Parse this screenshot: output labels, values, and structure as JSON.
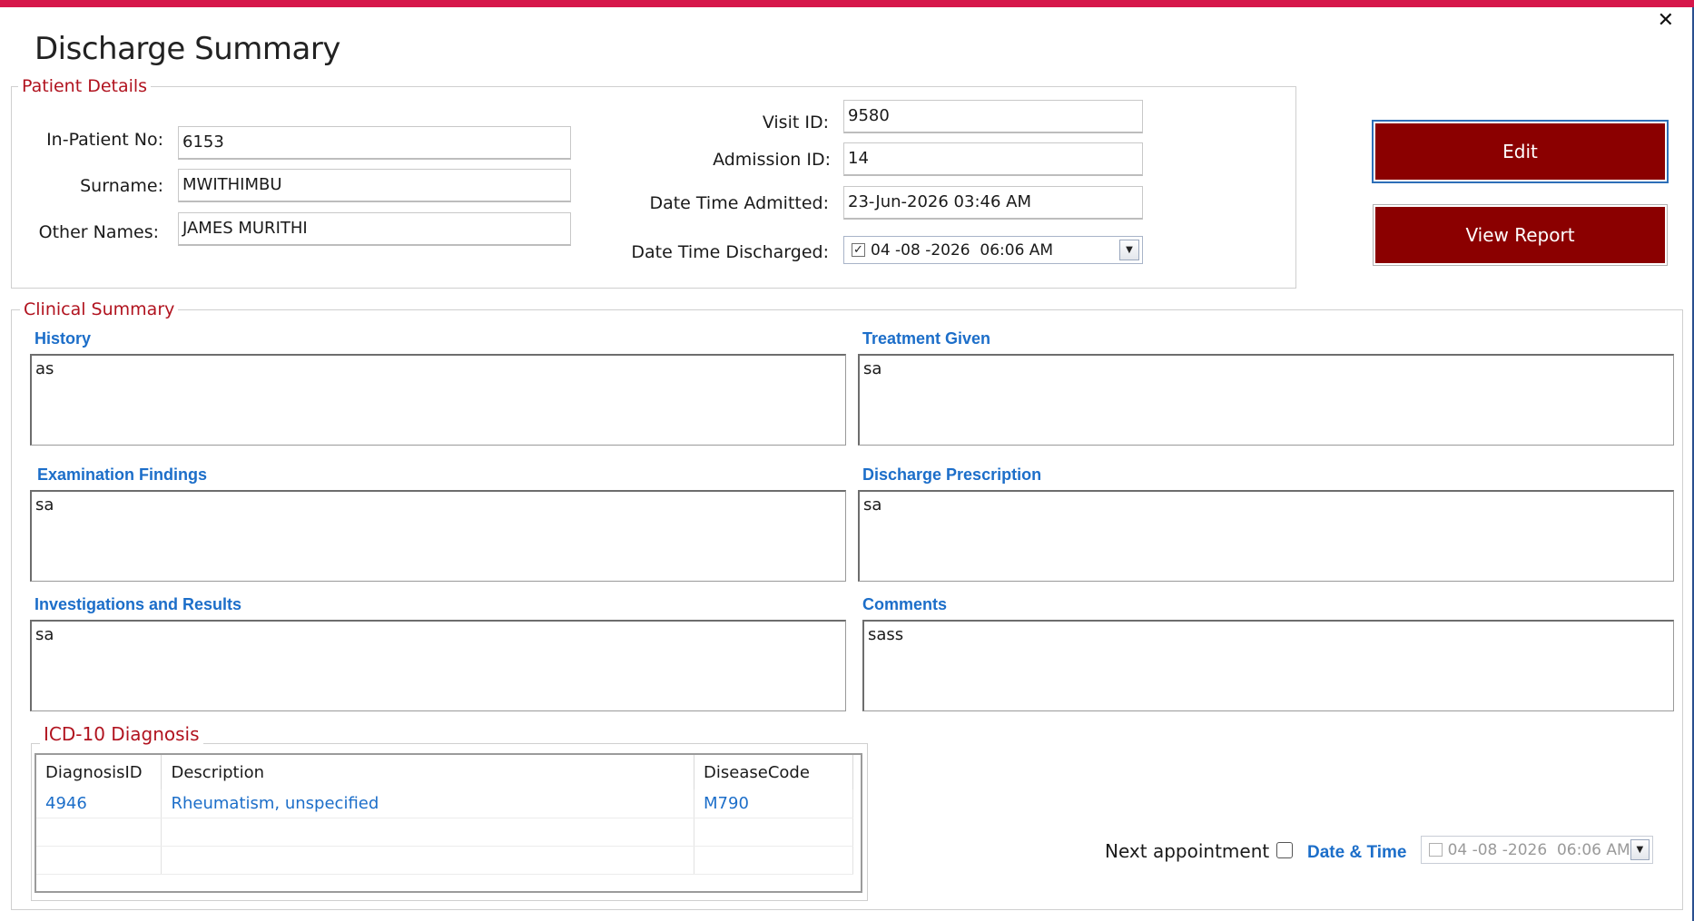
{
  "window": {
    "title": "Discharge Summary",
    "accent_color": "#d6174a",
    "close_icon": "close-icon"
  },
  "patient_details": {
    "legend": "Patient Details",
    "in_patient_no": {
      "label": "In-Patient No:",
      "value": "6153"
    },
    "surname": {
      "label": "Surname:",
      "value": "MWITHIMBU"
    },
    "other_names": {
      "label": "Other Names:",
      "value": "JAMES MURITHI"
    },
    "visit_id": {
      "label": "Visit ID:",
      "value": "9580"
    },
    "admission_id": {
      "label": "Admission ID:",
      "value": "14"
    },
    "date_admitted": {
      "label": "Date Time Admitted:",
      "value": "23-Jun-2026 03:46 AM"
    },
    "date_discharged": {
      "label": "Date Time Discharged:",
      "value": "04 -08 -2026  06:06 AM",
      "checked": true
    }
  },
  "actions": {
    "edit_label": "Edit",
    "view_report_label": "View Report",
    "button_color": "#8b0000"
  },
  "clinical_summary": {
    "legend": "Clinical Summary",
    "history": {
      "label": "History",
      "value": "as"
    },
    "treatment_given": {
      "label": "Treatment Given",
      "value": "sa"
    },
    "examination_findings": {
      "label": "Examination Findings",
      "value": "sa"
    },
    "discharge_prescription": {
      "label": "Discharge Prescription",
      "value": "sa"
    },
    "investigations": {
      "label": "Investigations and Results",
      "value": "sa"
    },
    "comments": {
      "label": "Comments",
      "value": "sass"
    }
  },
  "icd10": {
    "legend": "ICD-10 Diagnosis",
    "columns": [
      "DiagnosisID",
      "Description",
      "DiseaseCode"
    ],
    "rows": [
      [
        "4946",
        "Rheumatism, unspecified",
        "M790"
      ]
    ]
  },
  "appointment": {
    "next_label": "Next appointment",
    "next_checked": false,
    "datetime_label": "Date & Time",
    "datetime_value": "04 -08 -2026  06:06 AM",
    "datetime_checked": false
  }
}
